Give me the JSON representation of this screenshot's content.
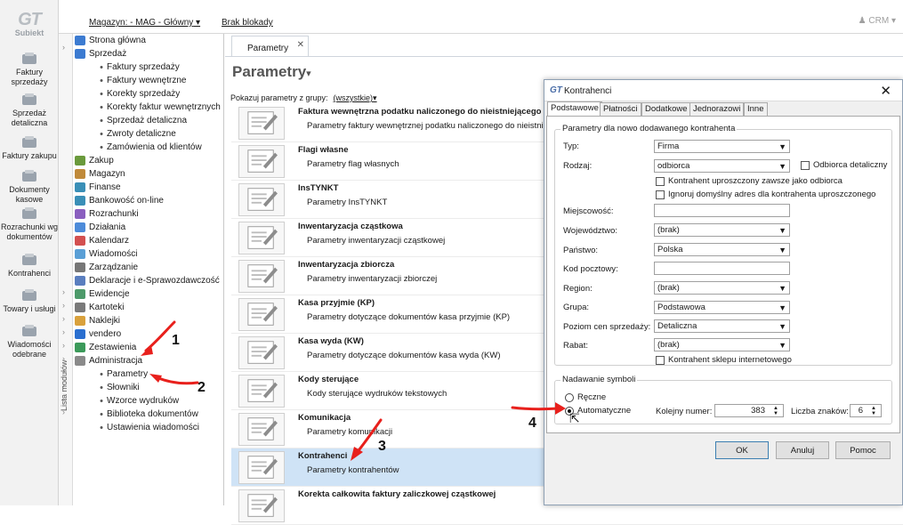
{
  "app": {
    "logo": "Subiekt"
  },
  "leftnav": {
    "items": [
      {
        "label": "Faktury sprzedaży"
      },
      {
        "label": "Sprzedaż detaliczna"
      },
      {
        "label": "Faktury zakupu"
      },
      {
        "label": "Dokumenty kasowe"
      },
      {
        "label": "Rozrachunki wg dokumentów"
      },
      {
        "label": "Kontrahenci"
      },
      {
        "label": "Towary i usługi"
      },
      {
        "label": "Wiadomości odebrane"
      }
    ]
  },
  "topbar": {
    "magazyn": "Magazyn: - MAG - Główny",
    "blokada": "Brak blokady",
    "crm": "CRM"
  },
  "modules_label": "Lista modułów",
  "tree": {
    "items": [
      {
        "label": "Strona główna",
        "level": 0,
        "color": "#3c7bd1"
      },
      {
        "label": "Sprzedaż",
        "level": 0,
        "color": "#3c7bd1"
      },
      {
        "label": "Faktury sprzedaży",
        "level": 1
      },
      {
        "label": "Faktury wewnętrzne",
        "level": 1
      },
      {
        "label": "Korekty sprzedaży",
        "level": 1
      },
      {
        "label": "Korekty faktur wewnętrznych",
        "level": 1
      },
      {
        "label": "Sprzedaż detaliczna",
        "level": 1
      },
      {
        "label": "Zwroty detaliczne",
        "level": 1
      },
      {
        "label": "Zamówienia od klientów",
        "level": 1
      },
      {
        "label": "Zakup",
        "level": 0,
        "color": "#6a9a3c"
      },
      {
        "label": "Magazyn",
        "level": 0,
        "color": "#c08a3a"
      },
      {
        "label": "Finanse",
        "level": 0,
        "color": "#3a8fb7"
      },
      {
        "label": "Bankowość on-line",
        "level": 0,
        "color": "#3a8fb7"
      },
      {
        "label": "Rozrachunki",
        "level": 0,
        "color": "#8a5fbf"
      },
      {
        "label": "Działania",
        "level": 0,
        "color": "#4d8bd9"
      },
      {
        "label": "Kalendarz",
        "level": 0,
        "color": "#d35050"
      },
      {
        "label": "Wiadomości",
        "level": 0,
        "color": "#5a9fd6"
      },
      {
        "label": "Zarządzanie",
        "level": 0,
        "color": "#777777"
      },
      {
        "label": "Deklaracje i e-Sprawozdawczość",
        "level": 0,
        "color": "#5a7ebf"
      },
      {
        "label": "Ewidencje",
        "level": 0,
        "color": "#4d9a6a"
      },
      {
        "label": "Kartoteki",
        "level": 0,
        "color": "#7a7a7a"
      },
      {
        "label": "Naklejki",
        "level": 0,
        "color": "#d9a13c"
      },
      {
        "label": "vendero",
        "level": 0,
        "color": "#2a6fd0"
      },
      {
        "label": "Zestawienia",
        "level": 0,
        "color": "#3c9a5a"
      },
      {
        "label": "Administracja",
        "level": 0,
        "color": "#8a8a8a"
      },
      {
        "label": "Parametry",
        "level": 1
      },
      {
        "label": "Słowniki",
        "level": 1
      },
      {
        "label": "Wzorce wydruków",
        "level": 1
      },
      {
        "label": "Biblioteka dokumentów",
        "level": 1
      },
      {
        "label": "Ustawienia wiadomości",
        "level": 1
      }
    ]
  },
  "main": {
    "tab": "Parametry",
    "title": "Parametry",
    "filter_label": "Pokazuj parametry z grupy:",
    "filter_value": "(wszystkie)",
    "rows": [
      {
        "title": "Faktura wewnętrzna podatku naliczonego do nieistniejącego",
        "desc": "Parametry faktury wewnętrznej podatku naliczonego do nieistniejącego"
      },
      {
        "title": "Flagi własne",
        "desc": "Parametry flag własnych"
      },
      {
        "title": "InsTYNKT",
        "desc": "Parametry InsTYNKT"
      },
      {
        "title": "Inwentaryzacja cząstkowa",
        "desc": "Parametry inwentaryzacji cząstkowej"
      },
      {
        "title": "Inwentaryzacja zbiorcza",
        "desc": "Parametry inwentaryzacji zbiorczej"
      },
      {
        "title": "Kasa przyjmie (KP)",
        "desc": "Parametry dotyczące dokumentów kasa przyjmie (KP)"
      },
      {
        "title": "Kasa wyda (KW)",
        "desc": "Parametry dotyczące dokumentów kasa wyda (KW)"
      },
      {
        "title": "Kody sterujące",
        "desc": "Kody sterujące wydruków tekstowych"
      },
      {
        "title": "Komunikacja",
        "desc": "Parametry komunikacji"
      },
      {
        "title": "Kontrahenci",
        "desc": "Parametry kontrahentów"
      },
      {
        "title": "Korekta całkowita faktury zaliczkowej cząstkowej",
        "desc": ""
      }
    ],
    "selected_row": 9
  },
  "dialog": {
    "title": "Kontrahenci",
    "tabs": [
      "Podstawowe",
      "Płatności",
      "Dodatkowe",
      "Jednorazowi",
      "Inne"
    ],
    "group1": "Parametry dla nowo dodawanego kontrahenta",
    "fields": {
      "typ": {
        "label": "Typ:",
        "value": "Firma"
      },
      "rodzaj": {
        "label": "Rodzaj:",
        "value": "odbiorca"
      },
      "odbiorca_det": "Odbiorca detaliczny",
      "uproszczony": "Kontrahent uproszczony zawsze jako odbiorca",
      "ignoruj": "Ignoruj domyślny adres dla kontrahenta uproszczonego",
      "miejscowosc": {
        "label": "Miejscowość:",
        "value": ""
      },
      "wojewodztwo": {
        "label": "Województwo:",
        "value": "(brak)"
      },
      "panstwo": {
        "label": "Państwo:",
        "value": "Polska"
      },
      "kod": {
        "label": "Kod pocztowy:",
        "value": ""
      },
      "region": {
        "label": "Region:",
        "value": "(brak)"
      },
      "grupa": {
        "label": "Grupa:",
        "value": "Podstawowa"
      },
      "poziom": {
        "label": "Poziom cen sprzedaży:",
        "value": "Detaliczna"
      },
      "rabat": {
        "label": "Rabat:",
        "value": "(brak)"
      },
      "sklep": "Kontrahent sklepu internetowego"
    },
    "group2": "Nadawanie symboli",
    "reczne": "Ręczne",
    "auto": "Automatyczne",
    "kolejny_label": "Kolejny numer:",
    "kolejny_value": "383",
    "liczba_label": "Liczba znaków:",
    "liczba_value": "6",
    "buttons": {
      "ok": "OK",
      "anuluj": "Anuluj",
      "pomoc": "Pomoc"
    }
  },
  "annotations": [
    "1",
    "2",
    "3",
    "4"
  ],
  "colors": {
    "annotation": "#e8201c",
    "selection": "#cfe3f6",
    "accent": "#3c7fb1"
  }
}
